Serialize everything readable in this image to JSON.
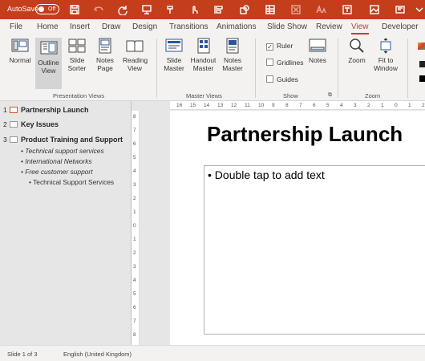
{
  "titlebar": {
    "autosave_label": "AutoSave",
    "autosave_state": "Off"
  },
  "menu": {
    "tabs": [
      "File",
      "Home",
      "Insert",
      "Draw",
      "Design",
      "Transitions",
      "Animations",
      "Slide Show",
      "Review",
      "View",
      "Developer"
    ],
    "active": "View"
  },
  "ribbon": {
    "presentation_views": {
      "normal": "Normal",
      "outline": "Outline View",
      "slide_sorter": "Slide Sorter",
      "notes_page": "Notes Page",
      "reading_view": "Reading View",
      "label": "Presentation Views"
    },
    "master_views": {
      "slide_master": "Slide Master",
      "handout_master": "Handout Master",
      "notes_master": "Notes Master",
      "label": "Master Views"
    },
    "show": {
      "ruler": "Ruler",
      "gridlines": "Gridlines",
      "guides": "Guides",
      "notes": "Notes",
      "label": "Show",
      "ruler_checked": true,
      "gridlines_checked": false,
      "guides_checked": false
    },
    "zoom": {
      "zoom": "Zoom",
      "fit": "Fit to Window",
      "label": "Zoom"
    }
  },
  "outline": {
    "slides": [
      {
        "num": "1",
        "title": "Partnership Launch"
      },
      {
        "num": "2",
        "title": "Key Issues"
      },
      {
        "num": "3",
        "title": "Product Training and Support"
      }
    ],
    "bullets": [
      "Technical support services",
      "International Networks",
      "Free customer support"
    ],
    "subbullet": "Technical Support Services"
  },
  "ruler": {
    "h": [
      "16",
      "15",
      "14",
      "13",
      "12",
      "11",
      "10",
      "9",
      "8",
      "7",
      "6",
      "5",
      "4",
      "3",
      "2",
      "1",
      "0",
      "1",
      "2"
    ],
    "v": [
      "8",
      "7",
      "6",
      "5",
      "4",
      "3",
      "2",
      "1",
      "0",
      "1",
      "2",
      "3",
      "4",
      "5",
      "6",
      "7",
      "8"
    ]
  },
  "slide": {
    "title": "Partnership Launch",
    "placeholder": "Double tap to add text",
    "bullet": "•"
  },
  "status": {
    "slide_count": "Slide 1 of 3",
    "language": "English (United Kingdom)"
  },
  "colors": {
    "accent": "#c43e1c",
    "active_tab": "#b7472a"
  }
}
